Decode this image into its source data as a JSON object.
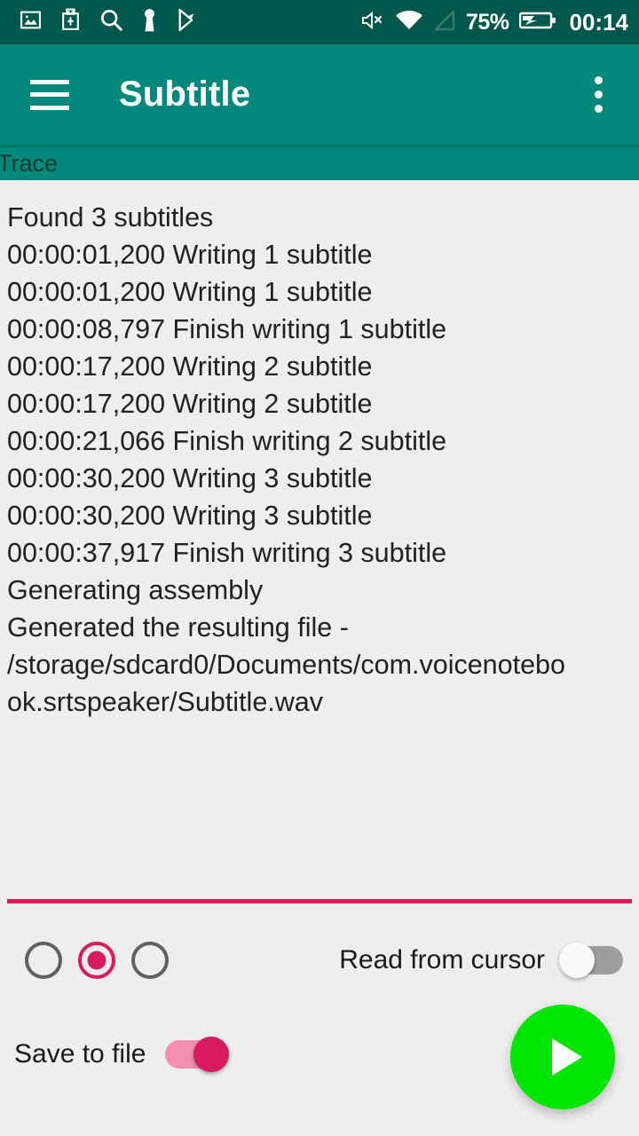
{
  "status_bar": {
    "icons_left": [
      "image-icon",
      "usb-icon",
      "search-icon",
      "keyhole-icon",
      "play-store-icon"
    ],
    "mute_icon": "volume-mute-icon",
    "wifi_icon": "wifi-icon",
    "signal_icon": "cell-signal-empty-icon",
    "battery_percent": "75%",
    "battery_icon": "battery-charging-icon",
    "clock": "00:14",
    "background": "#00574B"
  },
  "toolbar": {
    "menu_icon": "hamburger-menu-icon",
    "title": "Subtitle",
    "overflow_icon": "overflow-menu-icon",
    "background": "#00897B"
  },
  "trace": {
    "label": "Trace"
  },
  "log": {
    "lines": [
      "Found 3 subtitles",
      "00:00:01,200 Writing 1 subtitle",
      "00:00:01,200 Writing 1 subtitle",
      "00:00:08,797 Finish writing 1 subtitle",
      "00:00:17,200 Writing 2 subtitle",
      "00:00:17,200 Writing 2 subtitle",
      "00:00:21,066 Finish writing 2 subtitle",
      "00:00:30,200 Writing 3 subtitle",
      "00:00:30,200 Writing 3 subtitle",
      "00:00:37,917 Finish writing 3 subtitle",
      "Generating assembly",
      "Generated the resulting file - /storage/sdcard0/Documents/com.voicenotebook.srtspeaker/Subtitle.wav"
    ]
  },
  "controls": {
    "divider_color": "#D81B60",
    "accent_color": "#D81B60",
    "radios": [
      {
        "name": "radio-option-1",
        "checked": false
      },
      {
        "name": "radio-option-2",
        "checked": true
      },
      {
        "name": "radio-option-3",
        "checked": false
      }
    ],
    "read_from_cursor": {
      "label": "Read from cursor",
      "state": "off"
    },
    "save_to_file": {
      "label": "Save to file",
      "state": "on"
    },
    "play_button": {
      "name": "play-fab",
      "icon": "play-icon",
      "color": "#00E500"
    }
  }
}
